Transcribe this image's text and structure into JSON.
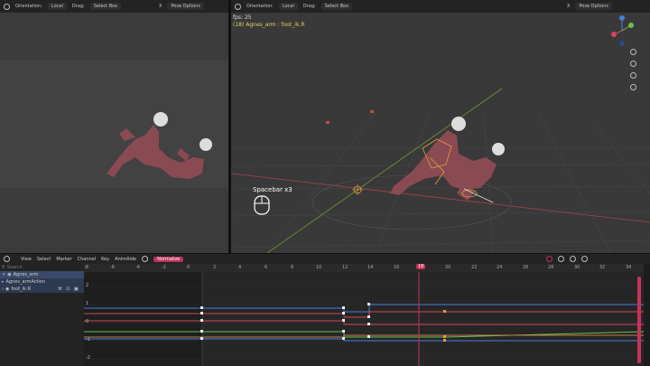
{
  "left_header": {
    "orientation_label": "Orientation:",
    "orientation_value": "Local",
    "drag_label": "Drag:",
    "drag_value": "Select Box",
    "x_label": "X",
    "pose_options": "Pose Options"
  },
  "right_header": {
    "orientation_label": "Orientation:",
    "orientation_value": "Local",
    "drag_label": "Drag:",
    "drag_value": "Select Box",
    "x_label": "X",
    "pose_options": "Pose Options"
  },
  "viewport": {
    "fps": "fps: 25",
    "object_info": "(18) Agnes_arm : foot_ik.R",
    "keystroke_overlay": "Spacebar x3",
    "gizmo_labels": [
      "Z",
      "Y",
      "X"
    ]
  },
  "graph_editor": {
    "menu": [
      "View",
      "Select",
      "Marker",
      "Channel",
      "Key",
      "AnimAide"
    ],
    "normalize_label": "Normalize",
    "search_placeholder": "Search",
    "channels": [
      {
        "label": "Agnes_arm"
      },
      {
        "label": "Agnes_armAction"
      },
      {
        "label": "foot_ik.R"
      }
    ],
    "frame_ticks": [
      "-8",
      "-6",
      "-4",
      "-2",
      "0",
      "2",
      "4",
      "6",
      "8",
      "10",
      "12",
      "14",
      "16",
      "18",
      "20",
      "22",
      "24",
      "26",
      "28",
      "30",
      "32",
      "34"
    ],
    "current_frame": "18",
    "y_ticks": [
      "2",
      "1",
      "0",
      "-1",
      "-2"
    ]
  },
  "colors": {
    "accent": "#c8325a",
    "curve_x": "#d0485a",
    "curve_y": "#6cc04a",
    "curve_z": "#4a7ce0",
    "selection": "#e0a040"
  }
}
